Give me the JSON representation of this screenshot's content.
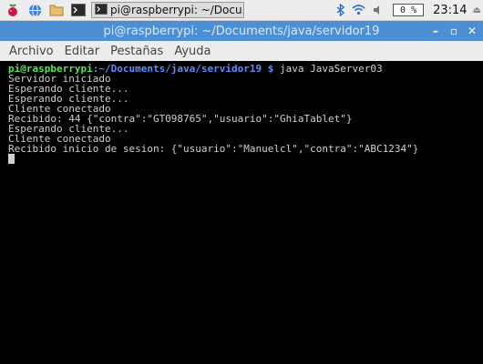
{
  "taskbar": {
    "window_button_label": "pi@raspberrypi: ~/Docu...",
    "cpu_usage": "0 %",
    "clock": "23:14"
  },
  "window": {
    "title": "pi@raspberrypi: ~/Documents/java/servidor19",
    "minimize": "–",
    "maximize": "▫",
    "close": "✕"
  },
  "menu": {
    "items": [
      "Archivo",
      "Editar",
      "Pestañas",
      "Ayuda"
    ]
  },
  "terminal": {
    "prompt_user": "pi@raspberrypi",
    "prompt_path": ":~/Documents/java/servidor19 $",
    "command": " java JavaServer03",
    "lines": [
      "Servidor iniciado",
      "Esperando cliente...",
      "Esperando cliente...",
      "Cliente conectado",
      "Recibido: 44 {\"contra\":\"GT098765\",\"usuario\":\"GhiaTablet\"}",
      "Esperando cliente...",
      "Cliente conectado",
      "Recibido inicio de sesion: {\"usuario\":\"Manuelcl\",\"contra\":\"ABC1234\"}"
    ]
  },
  "colors": {
    "titlebar": "#4d8fd4",
    "prompt_user": "#55e655",
    "prompt_path": "#5c8cff"
  }
}
